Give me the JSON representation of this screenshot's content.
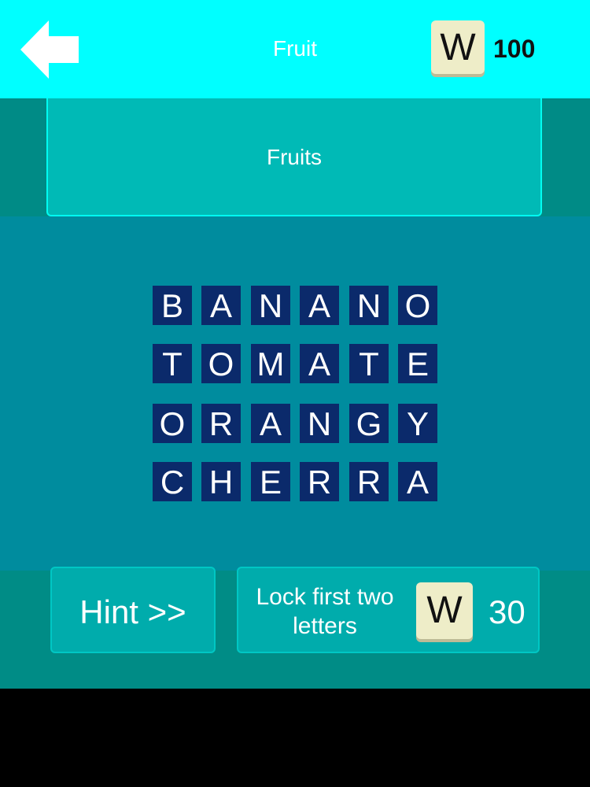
{
  "header": {
    "title": "Fruit",
    "coin_tile_letter": "W",
    "coins": "100"
  },
  "category": {
    "label": "Fruits"
  },
  "grid": {
    "rows": [
      [
        "B",
        "A",
        "N",
        "A",
        "N",
        "O"
      ],
      [
        "T",
        "O",
        "M",
        "A",
        "T",
        "E"
      ],
      [
        "O",
        "R",
        "A",
        "N",
        "G",
        "Y"
      ],
      [
        "C",
        "H",
        "E",
        "R",
        "R",
        "A"
      ]
    ]
  },
  "actions": {
    "hint_label": "Hint >>",
    "lock_label": "Lock first two letters",
    "lock_tile_letter": "W",
    "lock_cost": "30"
  },
  "colors": {
    "topbar": "#00FFFF",
    "tile": "#0B2A6B",
    "board": "#008C9E",
    "button": "#00ACAC"
  }
}
